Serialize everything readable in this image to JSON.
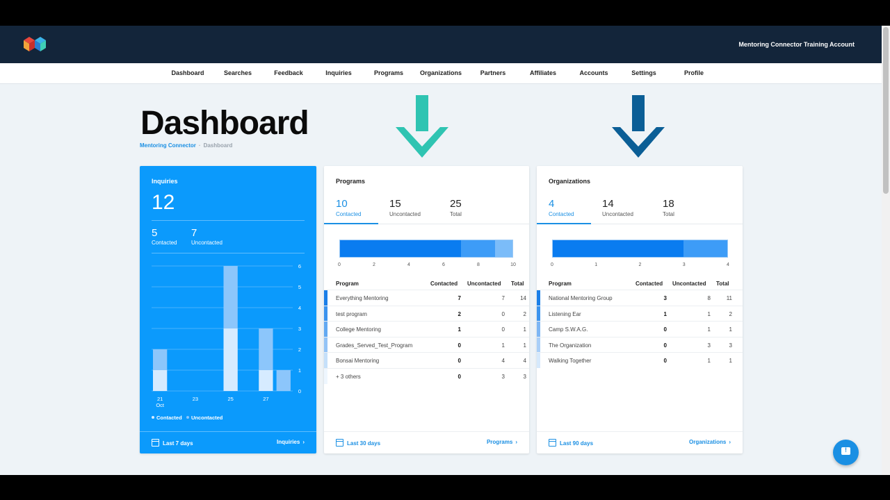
{
  "header": {
    "account_name": "Mentoring Connector Training Account"
  },
  "nav": {
    "items": [
      "Dashboard",
      "Searches",
      "Feedback",
      "Inquiries",
      "Programs",
      "Organizations",
      "Partners",
      "Affiliates",
      "Accounts",
      "Settings",
      "Profile"
    ]
  },
  "page": {
    "title": "Dashboard",
    "breadcrumb": {
      "link": "Mentoring Connector",
      "separator": "·",
      "current": "Dashboard"
    }
  },
  "colors": {
    "topbar": "#13253a",
    "accent": "#1a8fe3",
    "card_blue": "#0b9afc",
    "arrow_teal": "#2fc4b2",
    "arrow_navy": "#0b5e96"
  },
  "inquiries": {
    "title": "Inquiries",
    "total": "12",
    "contacted": "5",
    "contacted_label": "Contacted",
    "uncontacted": "7",
    "uncontacted_label": "Uncontacted",
    "legend_contacted": "Contacted",
    "legend_uncontacted": "Uncontacted",
    "x_labels": [
      "21",
      "23",
      "25",
      "27"
    ],
    "x_sublabel": "Oct",
    "footer_range": "Last 7 days",
    "footer_link": "Inquiries",
    "chart_data": {
      "type": "bar",
      "stacked": true,
      "categories": [
        "21",
        "22",
        "23",
        "24",
        "25",
        "26",
        "27",
        "28"
      ],
      "series": [
        {
          "name": "Contacted",
          "values": [
            1,
            0,
            0,
            0,
            3,
            0,
            1,
            0
          ]
        },
        {
          "name": "Uncontacted",
          "values": [
            1,
            0,
            0,
            0,
            3,
            0,
            2,
            1
          ]
        }
      ],
      "ylim": [
        0,
        6
      ],
      "yticks": [
        "0",
        "1",
        "2",
        "3",
        "4",
        "5",
        "6"
      ]
    }
  },
  "programs": {
    "title": "Programs",
    "contacted": "10",
    "contacted_label": "Contacted",
    "uncontacted": "15",
    "uncontacted_label": "Uncontacted",
    "total": "25",
    "total_label": "Total",
    "bar_ticks": [
      "0",
      "2",
      "4",
      "6",
      "8",
      "10"
    ],
    "bar_max": 10,
    "bar_segments": [
      7,
      2,
      1
    ],
    "table_headers": [
      "Program",
      "Contacted",
      "Uncontacted",
      "Total"
    ],
    "rows": [
      [
        "Everything Mentoring",
        "7",
        "7",
        "14"
      ],
      [
        "test program",
        "2",
        "0",
        "2"
      ],
      [
        "College Mentoring",
        "1",
        "0",
        "1"
      ],
      [
        "Grades_Served_Test_Program",
        "0",
        "1",
        "1"
      ],
      [
        "Bonsai Mentoring",
        "0",
        "4",
        "4"
      ],
      [
        "+ 3 others",
        "0",
        "3",
        "3"
      ]
    ],
    "footer_range": "Last 30 days",
    "footer_link": "Programs"
  },
  "organizations": {
    "title": "Organizations",
    "contacted": "4",
    "contacted_label": "Contacted",
    "uncontacted": "14",
    "uncontacted_label": "Uncontacted",
    "total": "18",
    "total_label": "Total",
    "bar_ticks": [
      "0",
      "1",
      "2",
      "3",
      "4"
    ],
    "bar_max": 4,
    "bar_segments": [
      3,
      1
    ],
    "table_headers": [
      "Program",
      "Contacted",
      "Uncontacted",
      "Total"
    ],
    "rows": [
      [
        "National Mentoring Group",
        "3",
        "8",
        "11"
      ],
      [
        "Listening Ear",
        "1",
        "1",
        "2"
      ],
      [
        "Camp S.W.A.G.",
        "0",
        "1",
        "1"
      ],
      [
        "The Organization",
        "0",
        "3",
        "3"
      ],
      [
        "Walking Together",
        "0",
        "1",
        "1"
      ]
    ],
    "footer_range": "Last 90 days",
    "footer_link": "Organizations"
  }
}
